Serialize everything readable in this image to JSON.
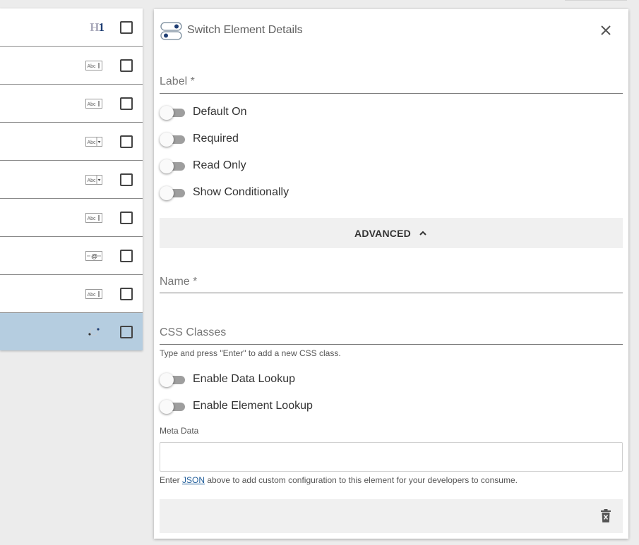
{
  "element_list": {
    "rows": [
      {
        "icon": "heading-icon",
        "icon_text_h": "H",
        "icon_text_num": "1",
        "selected": false
      },
      {
        "icon": "text-field-icon",
        "icon_text": "Abc",
        "selected": false
      },
      {
        "icon": "textarea-icon",
        "icon_text": "Abc",
        "selected": false
      },
      {
        "icon": "select-icon",
        "icon_text": "Abc",
        "selected": false
      },
      {
        "icon": "select-icon",
        "icon_text": "Abc",
        "selected": false
      },
      {
        "icon": "text-field-icon",
        "icon_text": "Abc",
        "selected": false
      },
      {
        "icon": "email-icon",
        "icon_text": "@",
        "selected": false
      },
      {
        "icon": "text-field-icon",
        "icon_text": "Abc",
        "selected": false
      },
      {
        "icon": "switch-element-icon",
        "selected": true
      }
    ]
  },
  "panel": {
    "title": "Switch Element Details",
    "label_field": {
      "label": "Label *",
      "value": ""
    },
    "toggles": [
      {
        "label": "Default On",
        "on": false
      },
      {
        "label": "Required",
        "on": false
      },
      {
        "label": "Read Only",
        "on": false
      },
      {
        "label": "Show Conditionally",
        "on": false
      }
    ],
    "advanced": {
      "label": "ADVANCED",
      "expanded": true
    },
    "name_field": {
      "label": "Name *",
      "value": ""
    },
    "css_field": {
      "label": "CSS Classes",
      "value": "",
      "helper": "Type and press \"Enter\" to add a new CSS class."
    },
    "lookup_toggles": [
      {
        "label": "Enable Data Lookup",
        "on": false
      },
      {
        "label": "Enable Element Lookup",
        "on": false
      }
    ],
    "meta_data": {
      "label": "Meta Data",
      "value": "",
      "helper_prefix": "Enter ",
      "helper_link": "JSON",
      "helper_suffix": " above to add custom configuration to this element for your developers to consume."
    }
  },
  "colors": {
    "selected_row": "#b5cde0",
    "link": "#1f5c99",
    "track": "#9e9e9e"
  }
}
